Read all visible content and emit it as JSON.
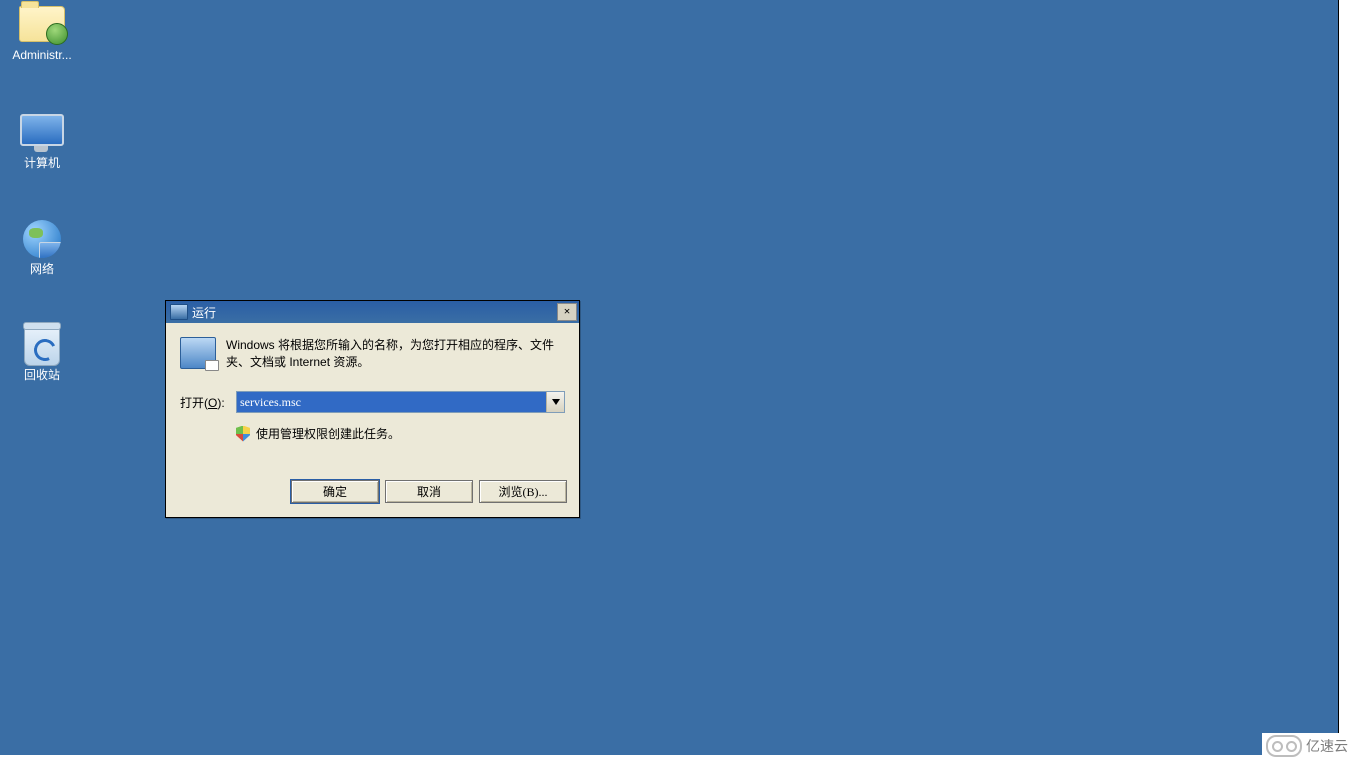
{
  "desktop": {
    "icons": [
      {
        "label": "Administr..."
      },
      {
        "label": "计算机"
      },
      {
        "label": "网络"
      },
      {
        "label": "回收站"
      }
    ]
  },
  "dialog": {
    "title": "运行",
    "description": "Windows 将根据您所输入的名称，为您打开相应的程序、文件夹、文档或 Internet 资源。",
    "open_label_prefix": "打开(",
    "open_label_key": "O",
    "open_label_suffix": "):",
    "input_value": "services.msc",
    "admin_text": "使用管理权限创建此任务。",
    "buttons": {
      "ok": "确定",
      "cancel": "取消",
      "browse": "浏览(B)..."
    }
  },
  "watermark": "亿速云"
}
